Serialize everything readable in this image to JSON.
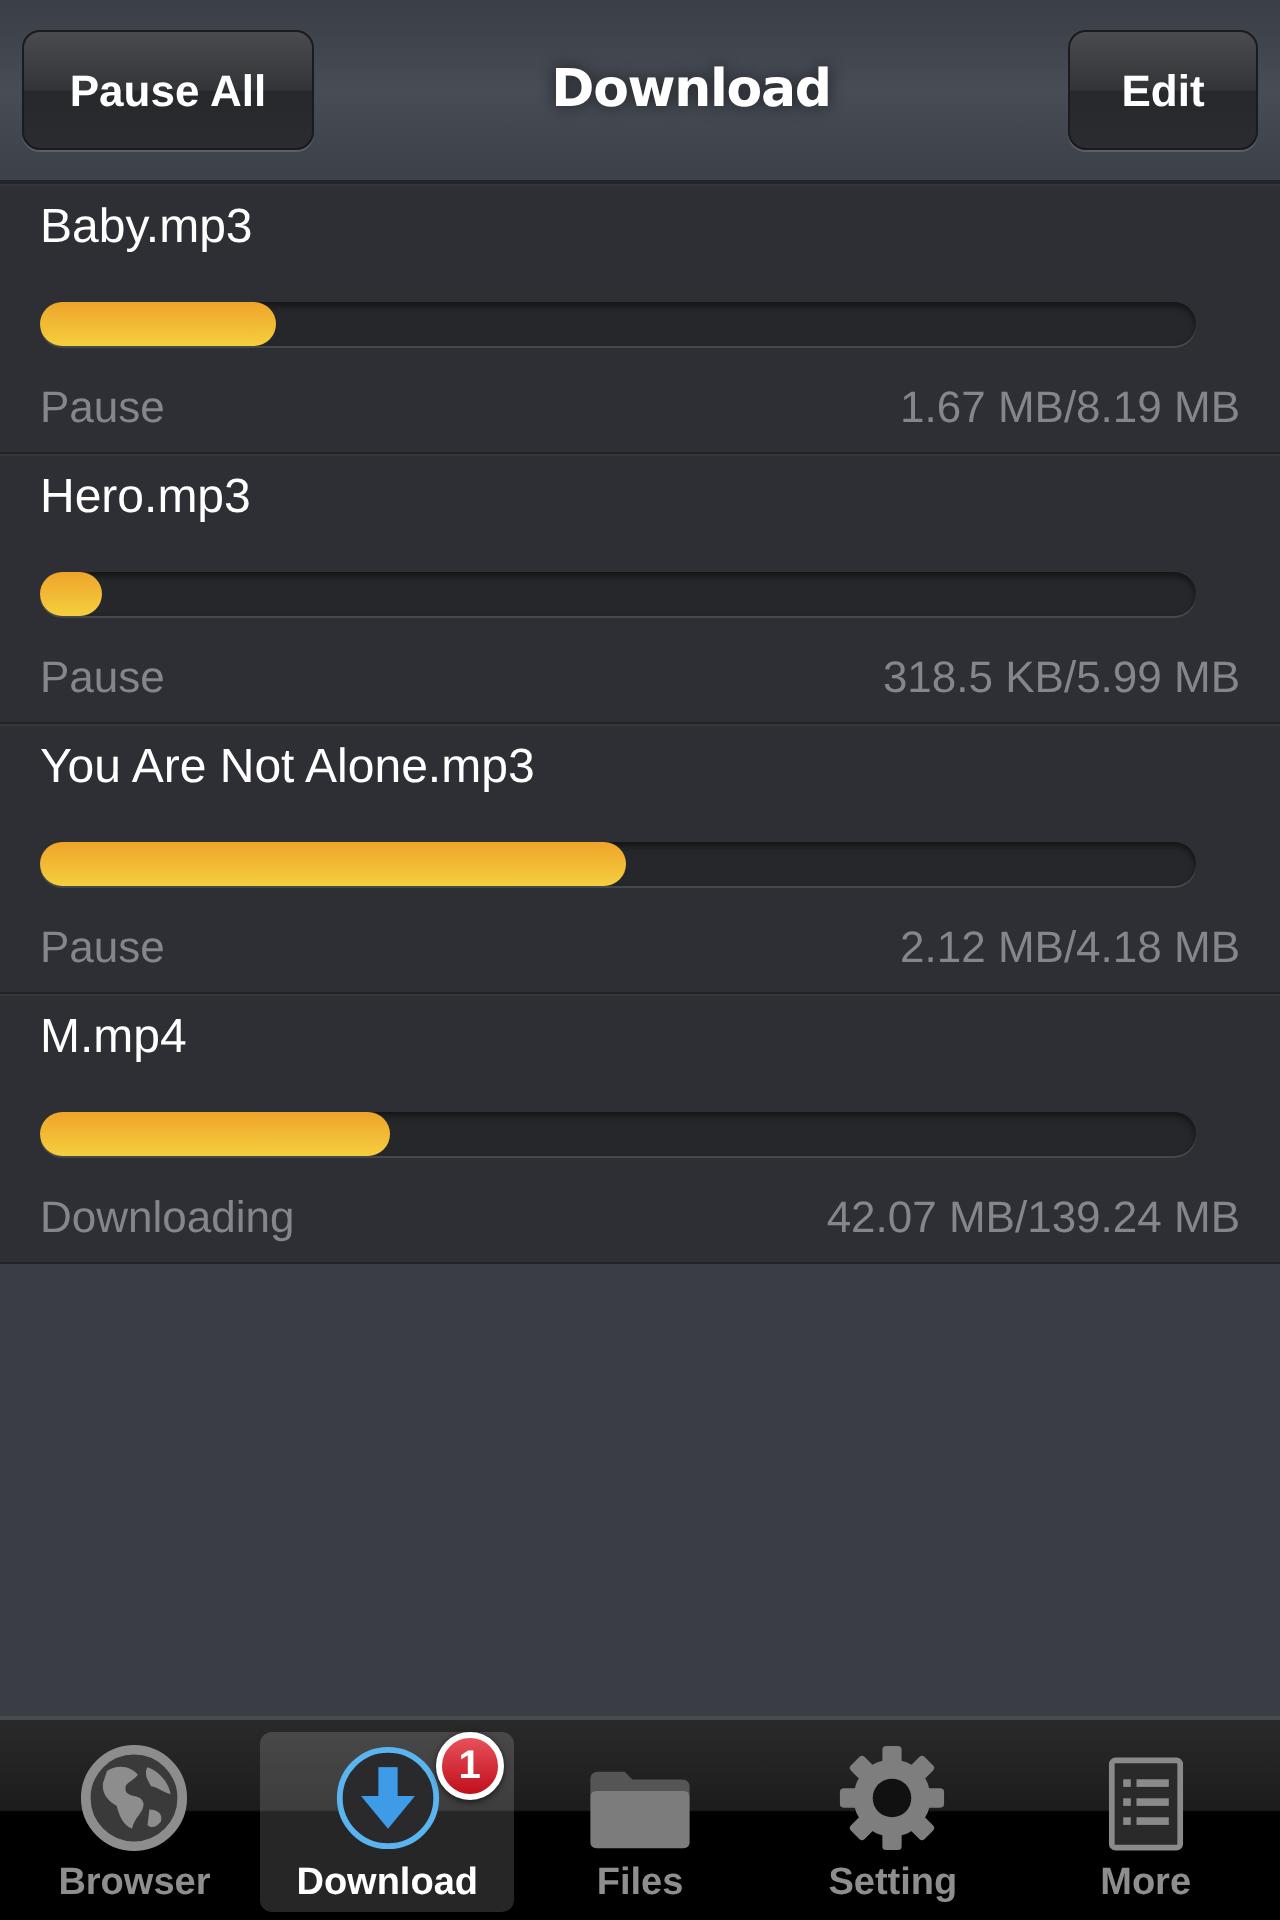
{
  "nav_bar": {
    "title": "Download",
    "left_button": "Pause All",
    "right_button": "Edit"
  },
  "downloads": [
    {
      "name": "Baby.mp3",
      "level": 0.204,
      "status": "Pause",
      "size": "1.67 MB/8.19 MB"
    },
    {
      "name": "Hero.mp3",
      "level": 0.053,
      "status": "Pause",
      "size": "318.5 KB/5.99 MB"
    },
    {
      "name": "You Are Not Alone.mp3",
      "level": 0.507,
      "status": "Pause",
      "size": "2.12 MB/4.18 MB"
    },
    {
      "name": "M.mp4",
      "level": 0.302,
      "status": "Downloading",
      "size": "42.07 MB/139.24 MB"
    }
  ],
  "tab_bar": [
    {
      "kind": "globe",
      "label": "Browser",
      "selected": false
    },
    {
      "kind": "download",
      "label": "Download",
      "selected": true,
      "badge": "1"
    },
    {
      "kind": "folder",
      "label": "Files",
      "selected": false
    },
    {
      "kind": "gear",
      "label": "Setting",
      "selected": false
    },
    {
      "kind": "list",
      "label": "More",
      "selected": false
    }
  ]
}
